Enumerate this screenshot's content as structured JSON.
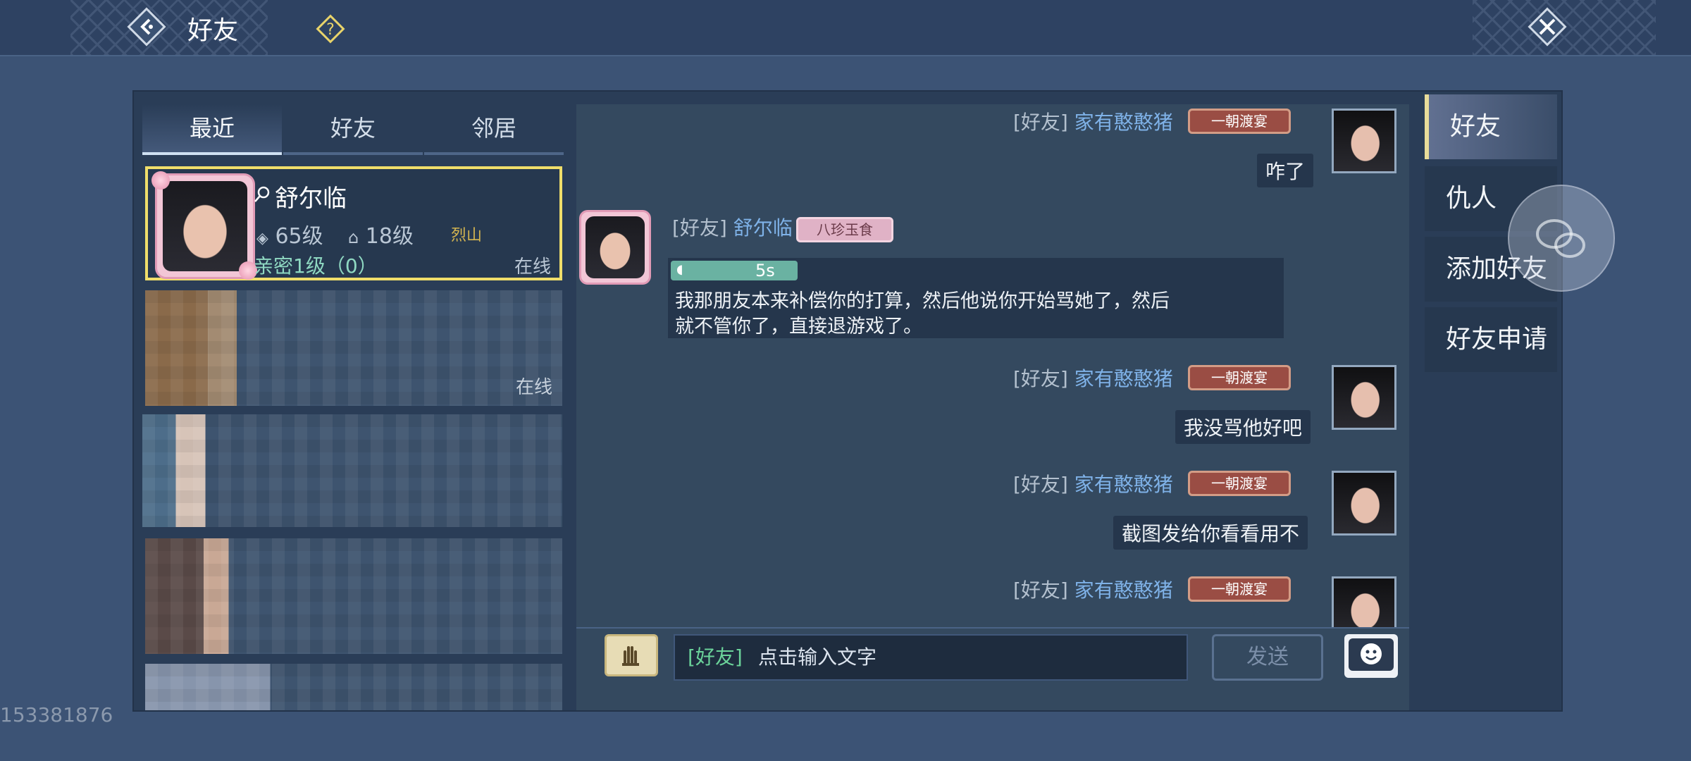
{
  "header": {
    "title": "好友",
    "colors": {
      "bar": "#2e4262",
      "accent": "#f0de6a"
    }
  },
  "tabs": [
    {
      "label": "最近",
      "active": true
    },
    {
      "label": "好友",
      "active": false
    },
    {
      "label": "邻居",
      "active": false
    }
  ],
  "friend": {
    "name": "舒尔临",
    "level": "65级",
    "house_level": "18级",
    "sect": "烈山",
    "intimacy": "亲密1级（0）",
    "status": "在线"
  },
  "blurred_rows": [
    {
      "status": "在线"
    },
    {
      "status": ""
    },
    {
      "status": ""
    },
    {
      "status": ""
    }
  ],
  "uid_watermark": "153381876",
  "chat": {
    "messages": [
      {
        "channel": "[好友]",
        "sender": "家有憨憨猪",
        "badge": "一朝渡宴",
        "text": "咋了",
        "mine": true
      },
      {
        "channel": "[好友]",
        "sender": "舒尔临",
        "badge": "八珍玉食",
        "voice_duration": "5s",
        "text": "我那朋友本来补偿你的打算，然后他说你开始骂她了，然后就不管你了，直接退游戏了。",
        "mine": false
      },
      {
        "channel": "[好友]",
        "sender": "家有憨憨猪",
        "badge": "一朝渡宴",
        "text": "我没骂他好吧",
        "mine": true
      },
      {
        "channel": "[好友]",
        "sender": "家有憨憨猪",
        "badge": "一朝渡宴",
        "text": "截图发给你看看用不",
        "mine": true
      },
      {
        "channel": "[好友]",
        "sender": "家有憨憨猪",
        "badge": "一朝渡宴",
        "text": "",
        "mine": true
      }
    ]
  },
  "input": {
    "channel_tag": "[好友]",
    "placeholder": "点击输入文字",
    "send_label": "发送"
  },
  "side_menu": [
    {
      "label": "好友",
      "active": true
    },
    {
      "label": "仇人",
      "active": false
    },
    {
      "label": "添加好友",
      "active": false
    },
    {
      "label": "好友申请",
      "active": false
    }
  ],
  "icons": [
    "back-arrow-icon",
    "help-question-icon",
    "close-x-icon",
    "voice-hand-icon",
    "emoji-smile-icon",
    "search-key-icon",
    "wechat-float-icon"
  ]
}
